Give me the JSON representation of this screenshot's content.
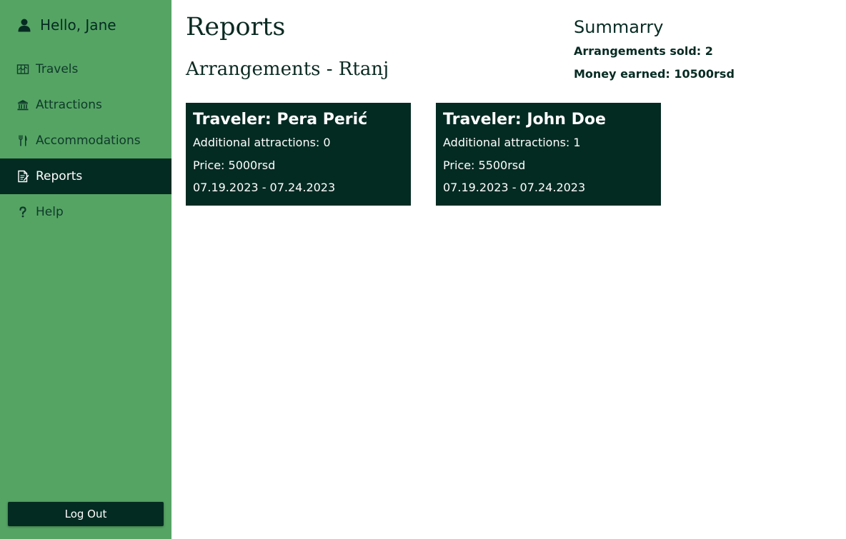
{
  "sidebar": {
    "greeting": "Hello, Jane",
    "items": [
      {
        "label": "Travels",
        "icon": "map-icon"
      },
      {
        "label": "Attractions",
        "icon": "museum-icon"
      },
      {
        "label": "Accommodations",
        "icon": "fork-knife-icon"
      },
      {
        "label": "Reports",
        "icon": "report-icon",
        "active": true
      },
      {
        "label": "Help",
        "icon": "question-icon"
      }
    ],
    "logout_label": "Log Out"
  },
  "main": {
    "title": "Reports",
    "subtitle": "Arrangements - Rtanj"
  },
  "summary": {
    "title": "Summarry",
    "arrangements_sold": "Arrangements sold: 2",
    "money_earned": "Money earned: 10500rsd"
  },
  "cards": [
    {
      "traveler": "Traveler: Pera Perić",
      "additional": "Additional attractions: 0",
      "price": "Price: 5000rsd",
      "dates": "07.19.2023 - 07.24.2023"
    },
    {
      "traveler": "Traveler: John Doe",
      "additional": "Additional attractions: 1",
      "price": "Price: 5500rsd",
      "dates": "07.19.2023 - 07.24.2023"
    }
  ],
  "colors": {
    "sidebar_bg": "#55a464",
    "dark_green": "#042b22",
    "text_dark": "#0b2a22"
  }
}
